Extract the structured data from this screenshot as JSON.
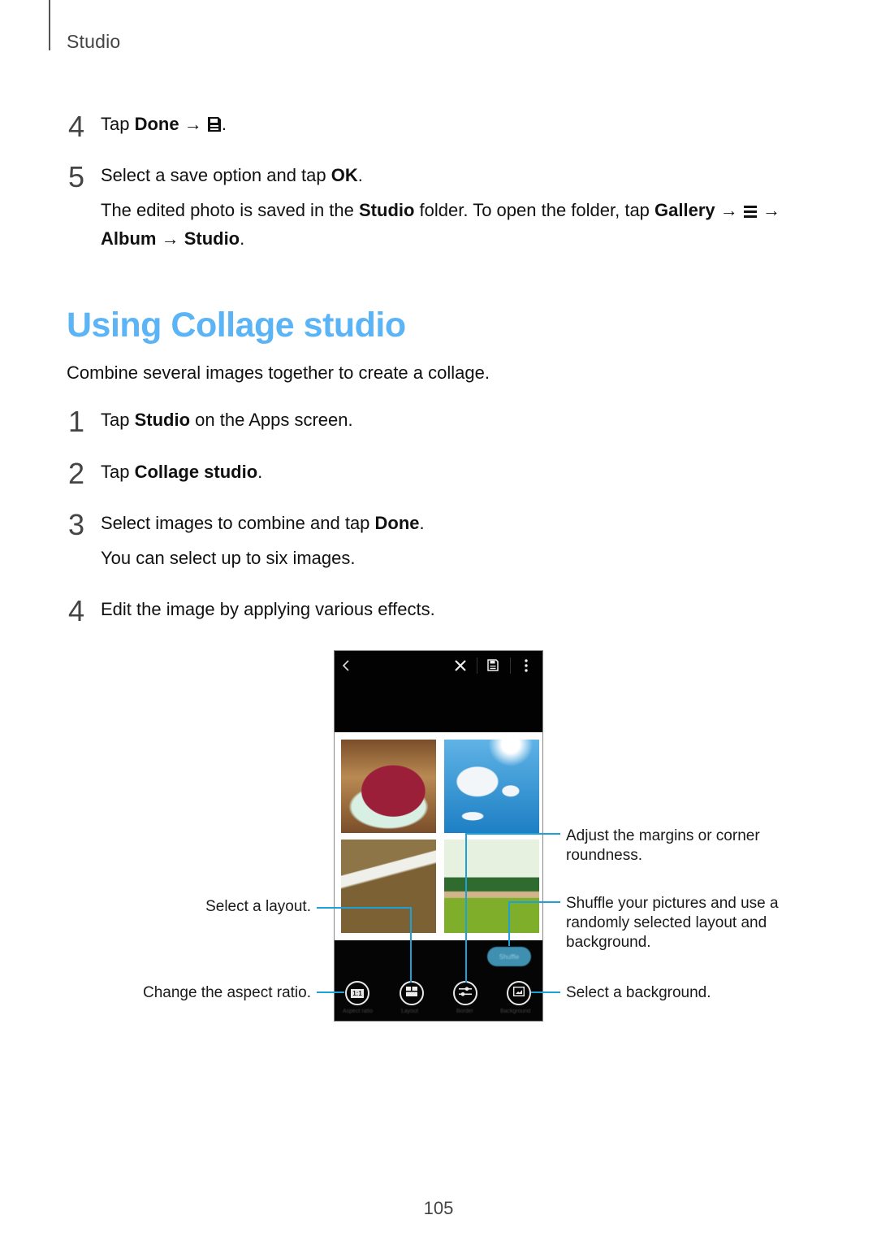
{
  "header": {
    "section": "Studio"
  },
  "prev_steps": [
    {
      "num": "4",
      "prefix": "Tap ",
      "bold": "Done",
      "arrow": " → ",
      "icon": "save-icon",
      "suffix": "."
    },
    {
      "num": "5",
      "prefix": "Select a save option and tap ",
      "bold": "OK",
      "suffix": "."
    }
  ],
  "save_note": {
    "t1": "The edited photo is saved in the ",
    "b1": "Studio",
    "t2": " folder. To open the folder, tap ",
    "b2": "Gallery",
    "arrow1": " → ",
    "icon": "menu-icon",
    "arrow2": " →",
    "b3": "Album",
    "arrow3": " → ",
    "b4": "Studio",
    "end": "."
  },
  "section": {
    "title": "Using Collage studio",
    "intro": "Combine several images together to create a collage."
  },
  "steps": [
    {
      "num": "1",
      "prefix": "Tap ",
      "bold": "Studio",
      "suffix": " on the Apps screen."
    },
    {
      "num": "2",
      "prefix": "Tap ",
      "bold": "Collage studio",
      "suffix": "."
    },
    {
      "num": "3",
      "prefix": "Select images to combine and tap ",
      "bold": "Done",
      "suffix": ".",
      "note": "You can select up to six images."
    },
    {
      "num": "4",
      "text": "Edit the image by applying various effects."
    }
  ],
  "screenshot": {
    "toolbar": {
      "back_icon": "back-chevron-icon",
      "close_icon": "close-icon",
      "save_icon": "save-icon",
      "more_icon": "more-vertical-icon"
    },
    "tiles": [
      {
        "name": "raspberry-tart-photo",
        "colors": [
          "#7a4e2a",
          "#9c1f3a",
          "#d8efe4"
        ]
      },
      {
        "name": "sky-clouds-photo",
        "colors": [
          "#1d7fc4",
          "#f2f6f8",
          "#5fb3e6"
        ]
      },
      {
        "name": "beach-waves-photo",
        "colors": [
          "#7b6134",
          "#f0f0ea",
          "#8e7547"
        ]
      },
      {
        "name": "coastal-field-photo",
        "colors": [
          "#e7f1e0",
          "#7fae2a",
          "#d2b48a"
        ]
      }
    ],
    "shuffle_label": "Shuffle",
    "tools": [
      {
        "name": "aspect-ratio",
        "icon": "aspect-ratio-icon",
        "glyph": "1:1",
        "label": "Aspect ratio"
      },
      {
        "name": "layout",
        "icon": "layout-grid-icon",
        "label": "Layout"
      },
      {
        "name": "border",
        "icon": "sliders-icon",
        "label": "Border"
      },
      {
        "name": "background",
        "icon": "background-image-icon",
        "label": "Background"
      }
    ]
  },
  "callouts": {
    "layout": "Select a layout.",
    "aspect": "Change the aspect ratio.",
    "margins": "Adjust the margins or corner roundness.",
    "shuffle": "Shuffle your pictures and use a randomly selected layout and background.",
    "background": "Select a background."
  },
  "colors": {
    "title_blue": "#5ab4f5",
    "callout_line": "#1ea0d8"
  },
  "footer": {
    "page_number": "105"
  }
}
